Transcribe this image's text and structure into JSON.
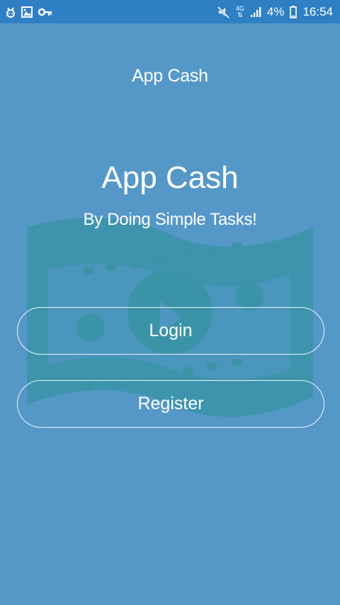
{
  "status_bar": {
    "left_icons": [
      "android-debug-icon",
      "image-icon",
      "key-icon"
    ],
    "network_type": "4G",
    "battery_percent": "4%",
    "time": "16:54"
  },
  "app": {
    "header_title": "App Cash",
    "title": "App Cash",
    "tagline": "By Doing Simple Tasks!"
  },
  "buttons": {
    "login_label": "Login",
    "register_label": "Register"
  },
  "colors": {
    "background": "#5598c8",
    "status_bar": "#2f7fc4",
    "art": "#3b93a8"
  }
}
